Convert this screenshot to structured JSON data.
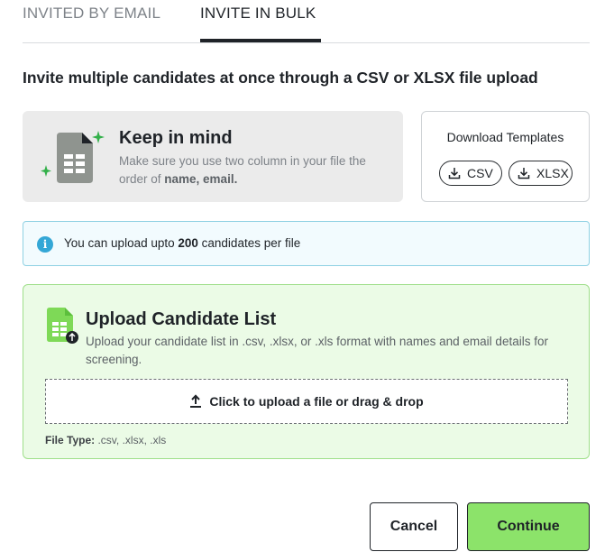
{
  "tabs": {
    "email": "INVITED BY EMAIL",
    "bulk": "INVITE IN BULK"
  },
  "heading": "Invite multiple candidates at once through a CSV or XLSX file upload",
  "keep_in_mind": {
    "title": "Keep in mind",
    "text_prefix": "Make sure you use two column in your file the order of ",
    "text_bold": "name, email."
  },
  "download": {
    "title": "Download Templates",
    "csv": "CSV",
    "xlsx": "XLSX"
  },
  "info": {
    "prefix": "You can upload upto ",
    "count": "200",
    "suffix": " candidates per file"
  },
  "upload": {
    "title": "Upload Candidate List",
    "description": "Upload your candidate list in .csv, .xlsx, or .xls format with names and email details for screening.",
    "drop_label": "Click to upload a file or drag & drop",
    "file_type_label": "File Type:",
    "file_types": " .csv, .xlsx, .xls"
  },
  "buttons": {
    "cancel": "Cancel",
    "continue": "Continue"
  },
  "colors": {
    "accent_green": "#8ce36a",
    "info_blue": "#34a7d6",
    "sheet_grey": "#8f948f",
    "sparkle_green": "#33b04a"
  }
}
